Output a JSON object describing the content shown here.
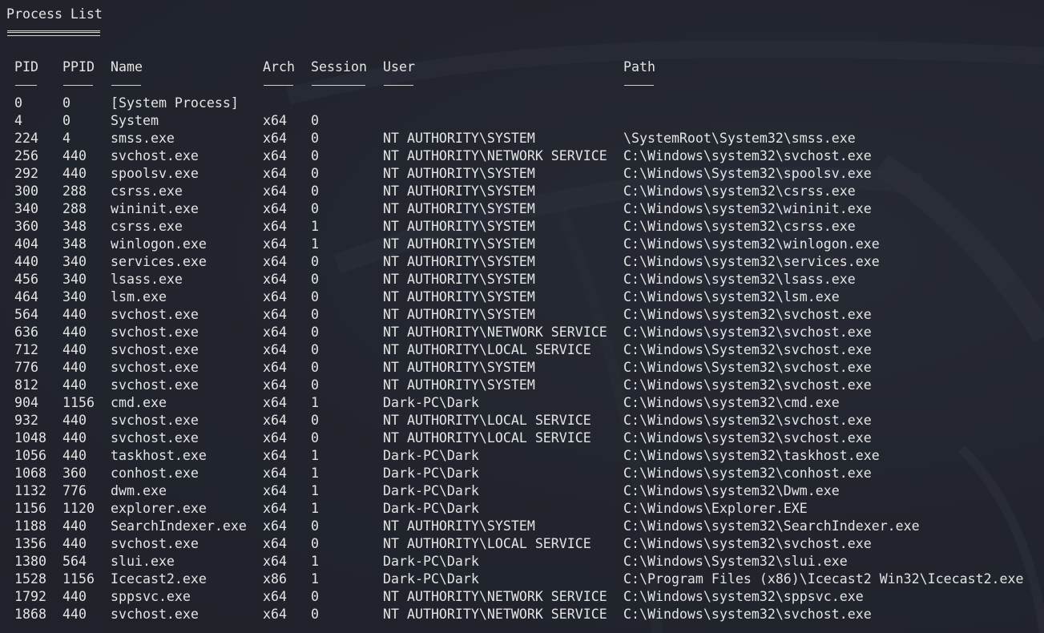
{
  "title": "Process List",
  "columns": {
    "pid": "PID",
    "ppid": "PPID",
    "name": "Name",
    "arch": "Arch",
    "session": "Session",
    "user": "User",
    "path": "Path"
  },
  "processes": [
    {
      "pid": "0",
      "ppid": "0",
      "name": "[System Process]",
      "arch": "",
      "session": "",
      "user": "",
      "path": ""
    },
    {
      "pid": "4",
      "ppid": "0",
      "name": "System",
      "arch": "x64",
      "session": "0",
      "user": "",
      "path": ""
    },
    {
      "pid": "224",
      "ppid": "4",
      "name": "smss.exe",
      "arch": "x64",
      "session": "0",
      "user": "NT AUTHORITY\\SYSTEM",
      "path": "\\SystemRoot\\System32\\smss.exe"
    },
    {
      "pid": "256",
      "ppid": "440",
      "name": "svchost.exe",
      "arch": "x64",
      "session": "0",
      "user": "NT AUTHORITY\\NETWORK SERVICE",
      "path": "C:\\Windows\\system32\\svchost.exe"
    },
    {
      "pid": "292",
      "ppid": "440",
      "name": "spoolsv.exe",
      "arch": "x64",
      "session": "0",
      "user": "NT AUTHORITY\\SYSTEM",
      "path": "C:\\Windows\\System32\\spoolsv.exe"
    },
    {
      "pid": "300",
      "ppid": "288",
      "name": "csrss.exe",
      "arch": "x64",
      "session": "0",
      "user": "NT AUTHORITY\\SYSTEM",
      "path": "C:\\Windows\\system32\\csrss.exe"
    },
    {
      "pid": "340",
      "ppid": "288",
      "name": "wininit.exe",
      "arch": "x64",
      "session": "0",
      "user": "NT AUTHORITY\\SYSTEM",
      "path": "C:\\Windows\\system32\\wininit.exe"
    },
    {
      "pid": "360",
      "ppid": "348",
      "name": "csrss.exe",
      "arch": "x64",
      "session": "1",
      "user": "NT AUTHORITY\\SYSTEM",
      "path": "C:\\Windows\\system32\\csrss.exe"
    },
    {
      "pid": "404",
      "ppid": "348",
      "name": "winlogon.exe",
      "arch": "x64",
      "session": "1",
      "user": "NT AUTHORITY\\SYSTEM",
      "path": "C:\\Windows\\system32\\winlogon.exe"
    },
    {
      "pid": "440",
      "ppid": "340",
      "name": "services.exe",
      "arch": "x64",
      "session": "0",
      "user": "NT AUTHORITY\\SYSTEM",
      "path": "C:\\Windows\\system32\\services.exe"
    },
    {
      "pid": "456",
      "ppid": "340",
      "name": "lsass.exe",
      "arch": "x64",
      "session": "0",
      "user": "NT AUTHORITY\\SYSTEM",
      "path": "C:\\Windows\\system32\\lsass.exe"
    },
    {
      "pid": "464",
      "ppid": "340",
      "name": "lsm.exe",
      "arch": "x64",
      "session": "0",
      "user": "NT AUTHORITY\\SYSTEM",
      "path": "C:\\Windows\\system32\\lsm.exe"
    },
    {
      "pid": "564",
      "ppid": "440",
      "name": "svchost.exe",
      "arch": "x64",
      "session": "0",
      "user": "NT AUTHORITY\\SYSTEM",
      "path": "C:\\Windows\\system32\\svchost.exe"
    },
    {
      "pid": "636",
      "ppid": "440",
      "name": "svchost.exe",
      "arch": "x64",
      "session": "0",
      "user": "NT AUTHORITY\\NETWORK SERVICE",
      "path": "C:\\Windows\\system32\\svchost.exe"
    },
    {
      "pid": "712",
      "ppid": "440",
      "name": "svchost.exe",
      "arch": "x64",
      "session": "0",
      "user": "NT AUTHORITY\\LOCAL SERVICE",
      "path": "C:\\Windows\\System32\\svchost.exe"
    },
    {
      "pid": "776",
      "ppid": "440",
      "name": "svchost.exe",
      "arch": "x64",
      "session": "0",
      "user": "NT AUTHORITY\\SYSTEM",
      "path": "C:\\Windows\\System32\\svchost.exe"
    },
    {
      "pid": "812",
      "ppid": "440",
      "name": "svchost.exe",
      "arch": "x64",
      "session": "0",
      "user": "NT AUTHORITY\\SYSTEM",
      "path": "C:\\Windows\\system32\\svchost.exe"
    },
    {
      "pid": "904",
      "ppid": "1156",
      "name": "cmd.exe",
      "arch": "x64",
      "session": "1",
      "user": "Dark-PC\\Dark",
      "path": "C:\\Windows\\system32\\cmd.exe"
    },
    {
      "pid": "932",
      "ppid": "440",
      "name": "svchost.exe",
      "arch": "x64",
      "session": "0",
      "user": "NT AUTHORITY\\LOCAL SERVICE",
      "path": "C:\\Windows\\system32\\svchost.exe"
    },
    {
      "pid": "1048",
      "ppid": "440",
      "name": "svchost.exe",
      "arch": "x64",
      "session": "0",
      "user": "NT AUTHORITY\\LOCAL SERVICE",
      "path": "C:\\Windows\\system32\\svchost.exe"
    },
    {
      "pid": "1056",
      "ppid": "440",
      "name": "taskhost.exe",
      "arch": "x64",
      "session": "1",
      "user": "Dark-PC\\Dark",
      "path": "C:\\Windows\\system32\\taskhost.exe"
    },
    {
      "pid": "1068",
      "ppid": "360",
      "name": "conhost.exe",
      "arch": "x64",
      "session": "1",
      "user": "Dark-PC\\Dark",
      "path": "C:\\Windows\\system32\\conhost.exe"
    },
    {
      "pid": "1132",
      "ppid": "776",
      "name": "dwm.exe",
      "arch": "x64",
      "session": "1",
      "user": "Dark-PC\\Dark",
      "path": "C:\\Windows\\system32\\Dwm.exe"
    },
    {
      "pid": "1156",
      "ppid": "1120",
      "name": "explorer.exe",
      "arch": "x64",
      "session": "1",
      "user": "Dark-PC\\Dark",
      "path": "C:\\Windows\\Explorer.EXE"
    },
    {
      "pid": "1188",
      "ppid": "440",
      "name": "SearchIndexer.exe",
      "arch": "x64",
      "session": "0",
      "user": "NT AUTHORITY\\SYSTEM",
      "path": "C:\\Windows\\system32\\SearchIndexer.exe"
    },
    {
      "pid": "1356",
      "ppid": "440",
      "name": "svchost.exe",
      "arch": "x64",
      "session": "0",
      "user": "NT AUTHORITY\\LOCAL SERVICE",
      "path": "C:\\Windows\\system32\\svchost.exe"
    },
    {
      "pid": "1380",
      "ppid": "564",
      "name": "slui.exe",
      "arch": "x64",
      "session": "1",
      "user": "Dark-PC\\Dark",
      "path": "C:\\Windows\\System32\\slui.exe"
    },
    {
      "pid": "1528",
      "ppid": "1156",
      "name": "Icecast2.exe",
      "arch": "x86",
      "session": "1",
      "user": "Dark-PC\\Dark",
      "path": "C:\\Program Files (x86)\\Icecast2 Win32\\Icecast2.exe"
    },
    {
      "pid": "1792",
      "ppid": "440",
      "name": "sppsvc.exe",
      "arch": "x64",
      "session": "0",
      "user": "NT AUTHORITY\\NETWORK SERVICE",
      "path": "C:\\Windows\\system32\\sppsvc.exe"
    },
    {
      "pid": "1868",
      "ppid": "440",
      "name": "svchost.exe",
      "arch": "x64",
      "session": "0",
      "user": "NT AUTHORITY\\NETWORK SERVICE",
      "path": "C:\\Windows\\system32\\svchost.exe"
    }
  ]
}
